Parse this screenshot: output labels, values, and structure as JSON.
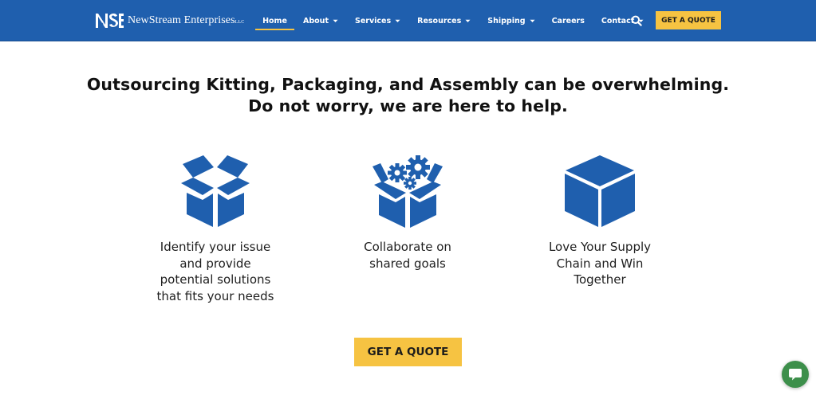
{
  "header": {
    "logo_text": "NewStream Enterprises",
    "logo_suffix": "LLC",
    "nav": [
      {
        "label": "Home",
        "active": true,
        "dropdown": false
      },
      {
        "label": "About",
        "active": false,
        "dropdown": true
      },
      {
        "label": "Services",
        "active": false,
        "dropdown": true
      },
      {
        "label": "Resources",
        "active": false,
        "dropdown": true
      },
      {
        "label": "Shipping",
        "active": false,
        "dropdown": true
      },
      {
        "label": "Careers",
        "active": false,
        "dropdown": false
      },
      {
        "label": "Contact",
        "active": false,
        "dropdown": true
      }
    ],
    "search_icon": "search-icon",
    "cta_label": "GET A QUOTE"
  },
  "main": {
    "headline_line1": "Outsourcing Kitting, Packaging, and Assembly can be overwhelming.",
    "headline_line2": "Do not worry, we are here to help.",
    "features": [
      {
        "icon": "open-box-icon",
        "lines": [
          "Identify your issue",
          "and provide",
          "potential solutions",
          "that fits your needs"
        ]
      },
      {
        "icon": "box-with-gears-icon",
        "lines": [
          "Collaborate on",
          "shared goals"
        ]
      },
      {
        "icon": "closed-box-icon",
        "lines": [
          "Love Your Supply",
          "Chain and Win",
          "Together"
        ]
      }
    ],
    "cta_label": "GET A QUOTE"
  },
  "chat": {
    "icon": "chat-bubble-icon"
  },
  "colors": {
    "header_bg": "#1f5fae",
    "accent": "#f6c342",
    "icon_blue": "#1f5fae",
    "chat_green": "#3d8f4b"
  }
}
